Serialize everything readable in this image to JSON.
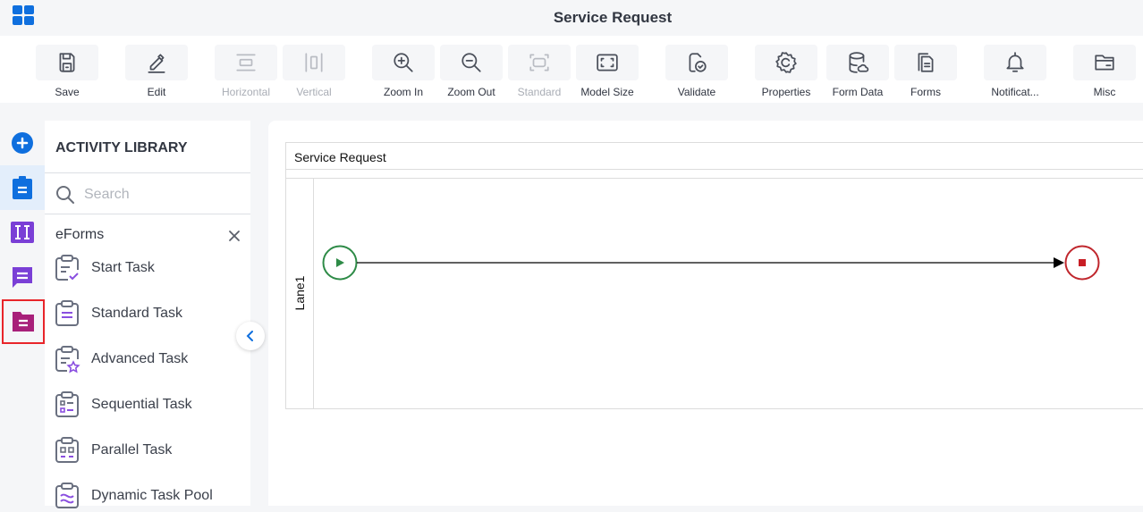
{
  "header": {
    "title": "Service Request",
    "app_menu_icon": "grid-icon"
  },
  "toolbar": {
    "buttons": [
      {
        "id": "save",
        "label": "Save",
        "icon": "save-icon",
        "enabled": true
      },
      {
        "id": "edit",
        "label": "Edit",
        "icon": "pencil-icon",
        "enabled": true
      },
      {
        "id": "horizontal",
        "label": "Horizontal",
        "icon": "horizontal-layout-icon",
        "enabled": false
      },
      {
        "id": "vertical",
        "label": "Vertical",
        "icon": "vertical-layout-icon",
        "enabled": false
      },
      {
        "id": "zoom-in",
        "label": "Zoom In",
        "icon": "zoom-in-icon",
        "enabled": true
      },
      {
        "id": "zoom-out",
        "label": "Zoom Out",
        "icon": "zoom-out-icon",
        "enabled": true
      },
      {
        "id": "standard",
        "label": "Standard",
        "icon": "standard-size-icon",
        "enabled": false
      },
      {
        "id": "model-size",
        "label": "Model Size",
        "icon": "fit-screen-icon",
        "enabled": true
      },
      {
        "id": "validate",
        "label": "Validate",
        "icon": "validate-icon",
        "enabled": true
      },
      {
        "id": "properties",
        "label": "Properties",
        "icon": "gear-icon",
        "enabled": true
      },
      {
        "id": "form-data",
        "label": "Form Data",
        "icon": "database-icon",
        "enabled": true
      },
      {
        "id": "forms",
        "label": "Forms",
        "icon": "forms-icon",
        "enabled": true
      },
      {
        "id": "notifications",
        "label": "Notificat...",
        "icon": "bell-icon",
        "enabled": true
      },
      {
        "id": "misc",
        "label": "Misc",
        "icon": "folder-icon",
        "enabled": true
      }
    ]
  },
  "rail": {
    "items": [
      {
        "name": "add",
        "icon": "plus-circle-icon",
        "color": "#0f6fde"
      },
      {
        "name": "tasks",
        "icon": "clipboard-icon",
        "color": "#0f6fde",
        "active": true
      },
      {
        "name": "variables",
        "icon": "text-cursor-icon",
        "color": "#7a3fd6"
      },
      {
        "name": "messages",
        "icon": "chat-icon",
        "color": "#7a3fd6"
      },
      {
        "name": "eforms",
        "icon": "folder-doc-icon",
        "color": "#a8207a",
        "selected": true
      }
    ]
  },
  "library": {
    "title": "ACTIVITY LIBRARY",
    "search_placeholder": "Search",
    "category": "eForms",
    "items": [
      {
        "label": "Start Task",
        "icon": "start-task-icon"
      },
      {
        "label": "Standard Task",
        "icon": "standard-task-icon"
      },
      {
        "label": "Advanced Task",
        "icon": "advanced-task-icon"
      },
      {
        "label": "Sequential Task",
        "icon": "sequential-task-icon"
      },
      {
        "label": "Parallel Task",
        "icon": "parallel-task-icon"
      },
      {
        "label": "Dynamic Task Pool",
        "icon": "dynamic-task-pool-icon"
      }
    ]
  },
  "canvas": {
    "pool_title": "Service Request",
    "lanes": [
      {
        "label": "Lane1"
      }
    ],
    "colors": {
      "start": "#2e8b47",
      "end": "#c0272d",
      "flow": "#000000"
    }
  }
}
